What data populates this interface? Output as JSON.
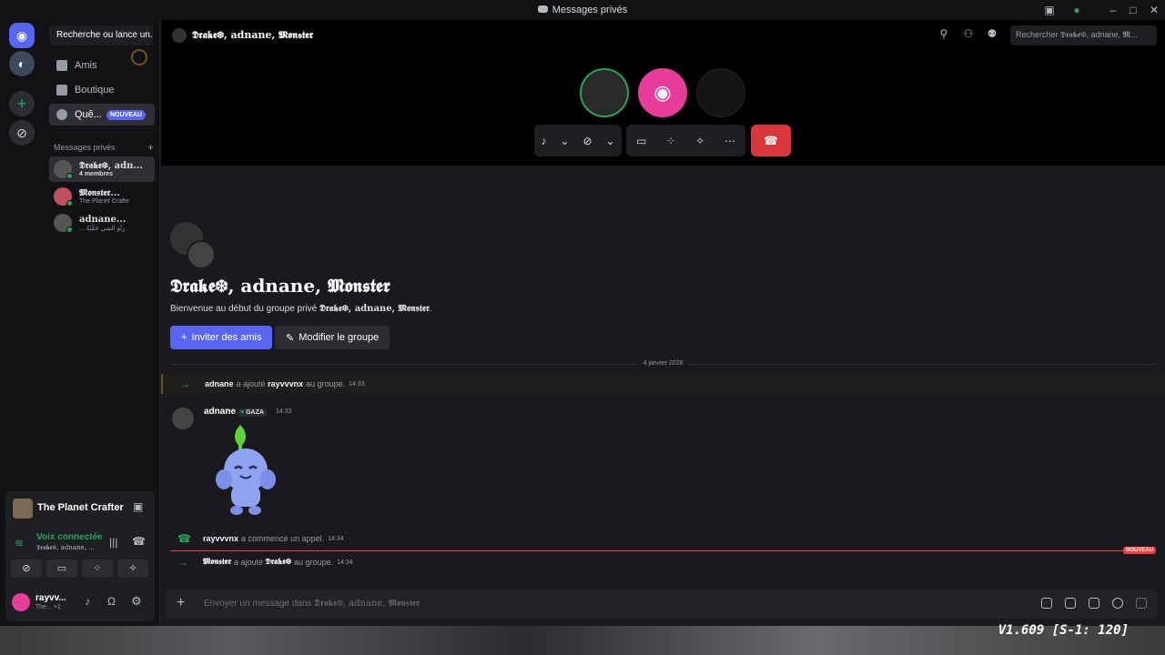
{
  "titlebar": {
    "title": "Messages privés"
  },
  "sidebar": {
    "search_label": "Recherche ou lance un...",
    "nav": [
      {
        "label": "Amis"
      },
      {
        "label": "Boutique"
      },
      {
        "label": "Quê...",
        "badge": "NOUVEAU"
      }
    ],
    "dm_header": "Messages privés",
    "dms": [
      {
        "name": "𝕯𝖗𝖆𝖐𝖊❆, adn...",
        "status": "4 membres"
      },
      {
        "name": "𝕸𝖔𝖓𝖘𝖙𝖊𝖗...",
        "status": "The Planet Crafte"
      },
      {
        "name": "adnane...",
        "status": "... زِنْوَ الشيِ جَفْنَهُ"
      }
    ]
  },
  "voice": {
    "game": "The Planet Crafter",
    "status": "Voix connectée",
    "channel": "𝕯𝖗𝖆𝖐𝖊❆, adnane, ..."
  },
  "user": {
    "name": "rayvv...",
    "status": "The... +1"
  },
  "header": {
    "title": "𝕯𝖗𝖆𝖐𝖊❆, adnane, 𝕸𝖔𝖓𝖘𝖙𝖊𝖗",
    "search_placeholder": "Rechercher 𝕯𝖗𝖆𝖐𝖊❆, adnane, 𝕸..."
  },
  "chat": {
    "group_title": "𝕯𝖗𝖆𝖐𝖊❆, adnane, 𝕸𝖔𝖓𝖘𝖙𝖊𝖗",
    "welcome_prefix": "Bienvenue au début du groupe privé ",
    "welcome_name": "𝕯𝖗𝖆𝖐𝖊❆, adnane, 𝕸𝖔𝖓𝖘𝖙𝖊𝖗",
    "welcome_suffix": ".",
    "invite_label": "Inviter des amis",
    "edit_label": "Modifier le groupe",
    "date": "4 janvier 2026",
    "sys1": {
      "actor": "adnane",
      "verb": "a ajouté",
      "target": "rayvvvnx",
      "suffix": "au groupe.",
      "time": "14:33"
    },
    "msg1": {
      "author": "adnane",
      "tag": "GAZA",
      "time": "14:33"
    },
    "sys2": {
      "actor": "rayvvvnx",
      "verb": "a commencé un appel.",
      "time": "14:34"
    },
    "new_label": "NOUVEAU",
    "sys3": {
      "actor": "𝕸𝖔𝖓𝖘𝖙𝖊𝖗",
      "verb": "a ajouté",
      "target": "𝕯𝖗𝖆𝖐𝖊❆",
      "suffix": "au groupe.",
      "time": "14:34"
    },
    "composer_prefix": "Envoyer un message dans ",
    "composer_name": "𝕯𝖗𝖆𝖐𝖊❆, adnane, 𝕸𝖔𝖓𝖘𝖙𝖊𝖗"
  },
  "overlay": {
    "version": "V1.609 [S-1: 120]"
  },
  "colors": {
    "accent": "#5865f2",
    "danger": "#da373c",
    "online": "#23a55a",
    "pink": "#e73c9a"
  }
}
